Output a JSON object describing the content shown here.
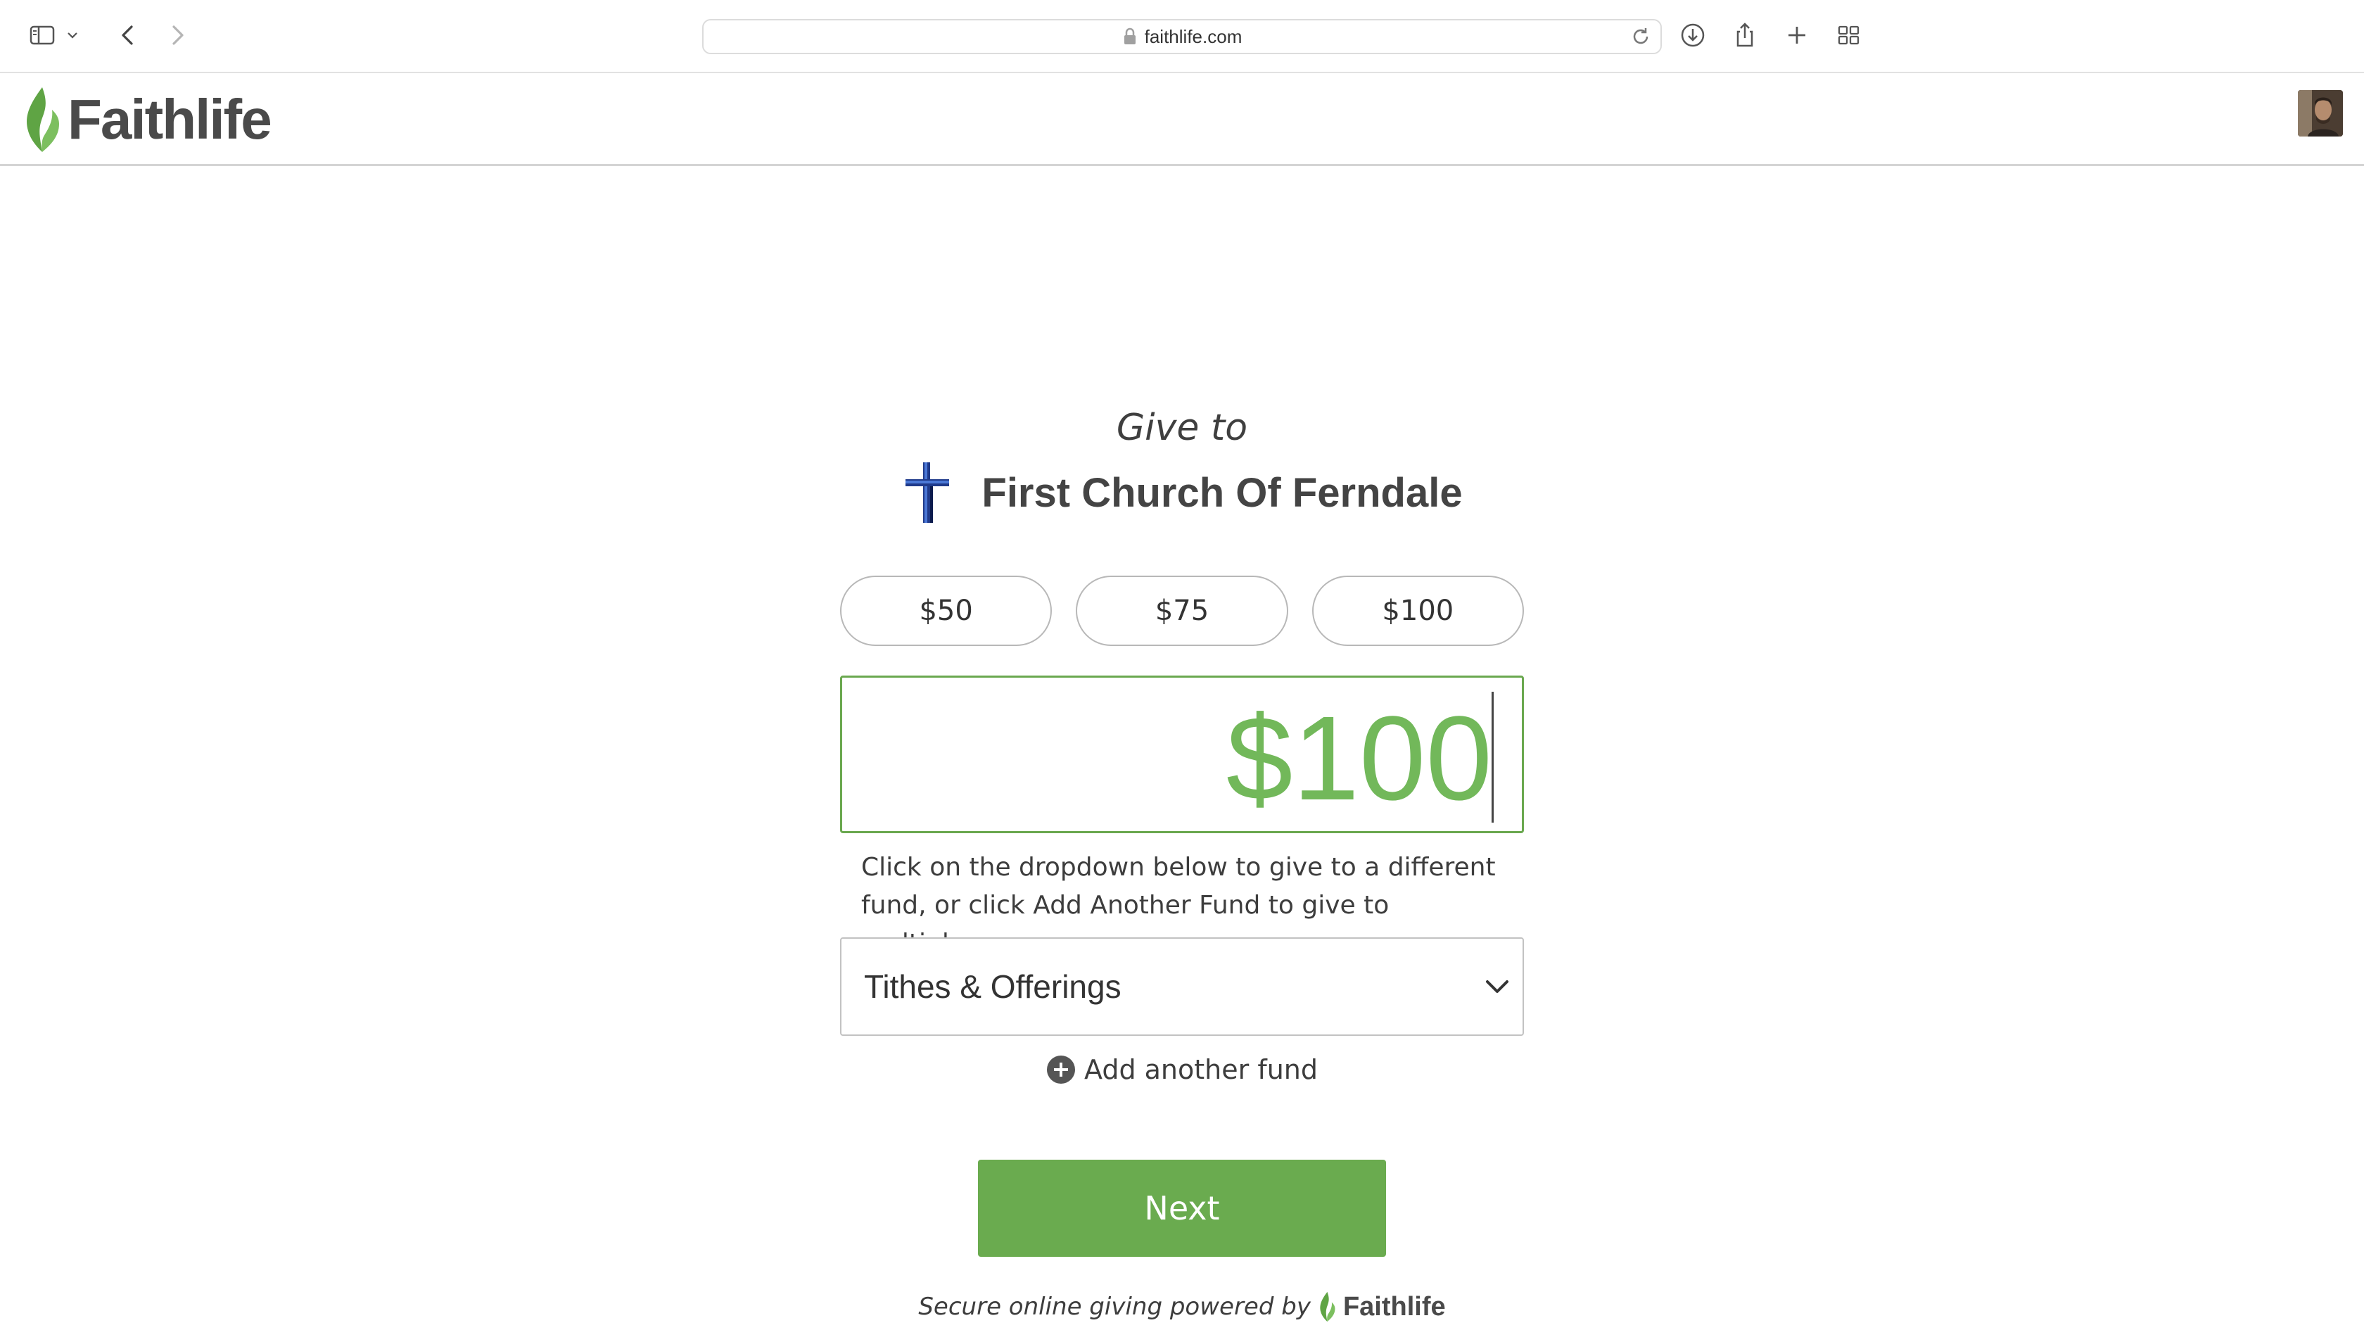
{
  "browser": {
    "url": "faithlife.com",
    "icons": [
      "sidebar-icon",
      "chevron-down-icon",
      "back-icon",
      "forward-icon",
      "lock-icon",
      "reload-icon",
      "download-icon",
      "share-icon",
      "new-tab-icon",
      "tab-overview-icon"
    ]
  },
  "header": {
    "brand": "Faithlife",
    "brand_color": "#6aab4f",
    "avatar_icon": "avatar"
  },
  "giving": {
    "give_to_label": "Give to",
    "organization": "First Church Of Ferndale",
    "preset_amounts": [
      "$50",
      "$75",
      "$100"
    ],
    "amount_value": "$100",
    "helper_text": "Click on the dropdown below to give to a different fund, or click Add Another Fund to give to multiple.",
    "fund_selected": "Tithes & Offerings",
    "add_fund_label": "Add another fund",
    "next_label": "Next",
    "accent_color": "#72b85a"
  },
  "footer": {
    "powered_by": "Secure online giving powered by",
    "brand": "Faithlife"
  }
}
